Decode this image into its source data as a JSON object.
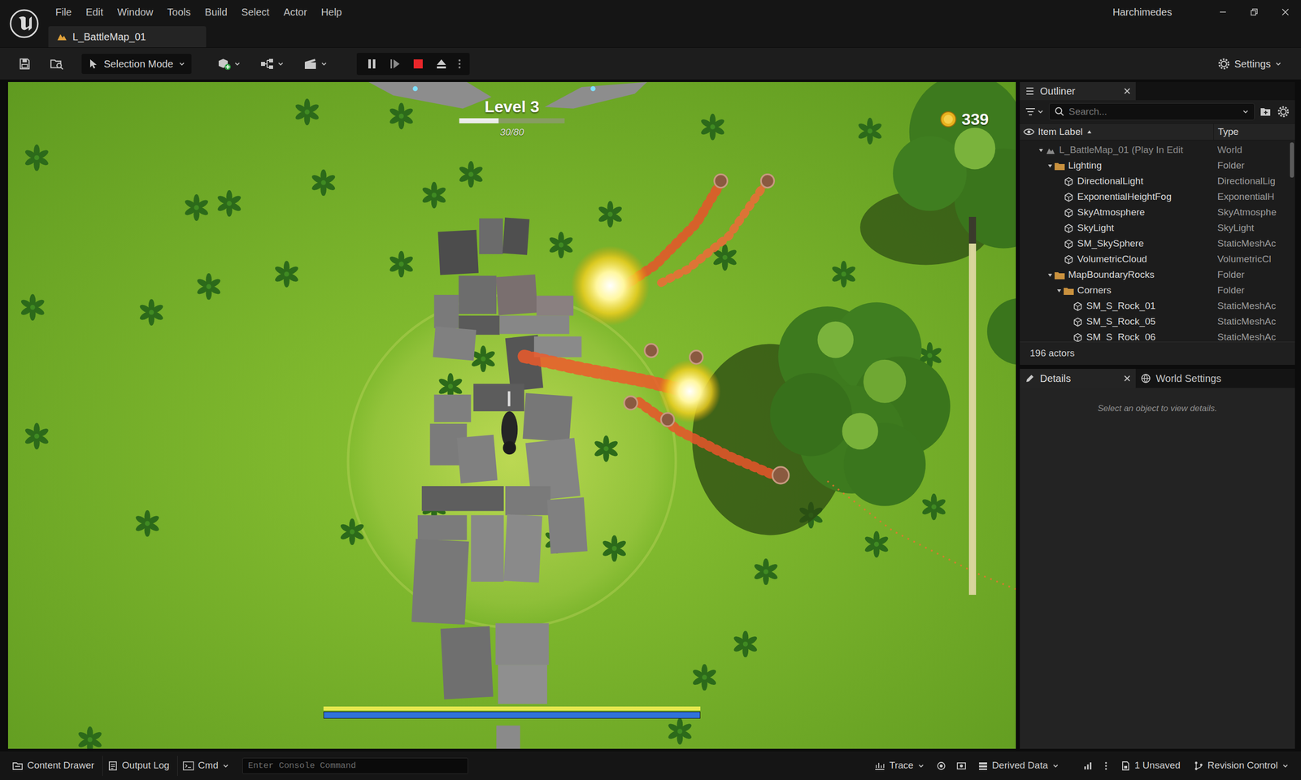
{
  "window": {
    "title": "Harchimedes"
  },
  "menu": [
    "File",
    "Edit",
    "Window",
    "Tools",
    "Build",
    "Select",
    "Actor",
    "Help"
  ],
  "tabs": [
    {
      "label": "L_BattleMap_01",
      "selected": true
    }
  ],
  "toolbar": {
    "mode": "Selection Mode",
    "settings": "Settings",
    "session_running": true
  },
  "hud": {
    "title": "Level 3",
    "xp_text": "30/80",
    "xp_level": 0.375,
    "coins": "339",
    "side_level": 0.93,
    "stamina_level": 1,
    "mana_level": 1
  },
  "outliner": {
    "title": "Outliner",
    "search_placeholder": "Search...",
    "columns": [
      "Item Label",
      "Type"
    ],
    "rows": [
      {
        "label": "L_BattleMap_01 (Play In Edit",
        "type": "World",
        "depth": 0,
        "kind": "world",
        "expanded": true,
        "dimmed": true
      },
      {
        "label": "Lighting",
        "type": "Folder",
        "depth": 1,
        "kind": "folder",
        "expanded": true,
        "dimmed": false
      },
      {
        "label": "DirectionalLight",
        "type": "DirectionalLig",
        "depth": 2,
        "kind": "actor",
        "expanded": false,
        "dimmed": false
      },
      {
        "label": "ExponentialHeightFog",
        "type": "ExponentialH",
        "depth": 2,
        "kind": "actor",
        "expanded": false,
        "dimmed": false
      },
      {
        "label": "SkyAtmosphere",
        "type": "SkyAtmosphe",
        "depth": 2,
        "kind": "actor",
        "expanded": false,
        "dimmed": false
      },
      {
        "label": "SkyLight",
        "type": "SkyLight",
        "depth": 2,
        "kind": "actor",
        "expanded": false,
        "dimmed": false
      },
      {
        "label": "SM_SkySphere",
        "type": "StaticMeshAc",
        "depth": 2,
        "kind": "actor",
        "expanded": false,
        "dimmed": false
      },
      {
        "label": "VolumetricCloud",
        "type": "VolumetricCl",
        "depth": 2,
        "kind": "actor",
        "expanded": false,
        "dimmed": false
      },
      {
        "label": "MapBoundaryRocks",
        "type": "Folder",
        "depth": 1,
        "kind": "folder",
        "expanded": true,
        "dimmed": false
      },
      {
        "label": "Corners",
        "type": "Folder",
        "depth": 2,
        "kind": "folder",
        "expanded": true,
        "dimmed": false
      },
      {
        "label": "SM_S_Rock_01",
        "type": "StaticMeshAc",
        "depth": 3,
        "kind": "actor",
        "expanded": false,
        "dimmed": false
      },
      {
        "label": "SM_S_Rock_05",
        "type": "StaticMeshAc",
        "depth": 3,
        "kind": "actor",
        "expanded": false,
        "dimmed": false
      },
      {
        "label": "SM_S_Rock_06",
        "type": "StaticMeshAc",
        "depth": 3,
        "kind": "actor",
        "expanded": false,
        "dimmed": false
      }
    ],
    "count": "196 actors"
  },
  "details": {
    "tabs": [
      {
        "label": "Details",
        "selected": true
      },
      {
        "label": "World Settings",
        "selected": false
      }
    ],
    "empty_text": "Select an object to view details."
  },
  "status_bar": {
    "left": [
      {
        "label": "Content Drawer"
      },
      {
        "label": "Output Log"
      },
      {
        "label": "Cmd"
      }
    ],
    "console_placeholder": "Enter Console Command",
    "right": [
      {
        "label": "Trace"
      },
      {
        "label": "Derived Data"
      },
      {
        "label": "1 Unsaved"
      },
      {
        "label": "Revision Control"
      }
    ]
  }
}
